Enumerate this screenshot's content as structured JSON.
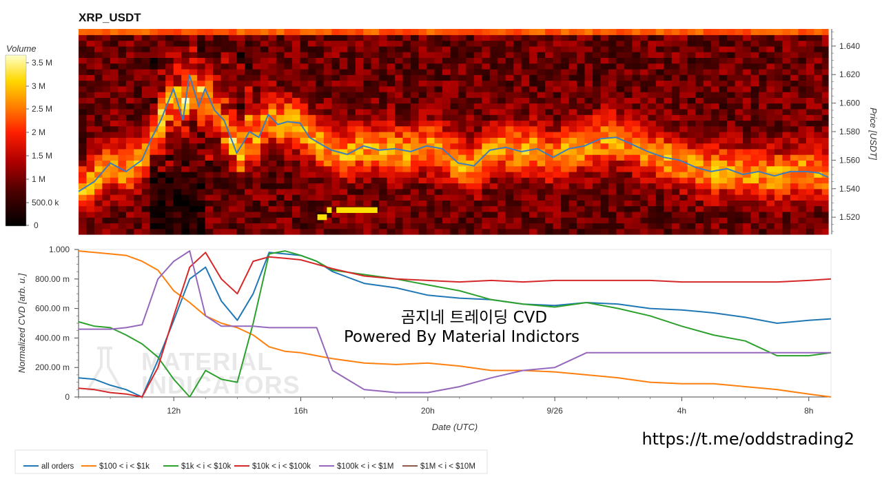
{
  "title": "XRP_USDT",
  "heatmap": {
    "colorbar_title": "Volume",
    "colorbar_ticks": [
      "3.5 M",
      "3 M",
      "2.5 M",
      "2 M",
      "1.5 M",
      "1 M",
      "500.0 k",
      "0"
    ],
    "price_ticks": [
      "1.640",
      "1.620",
      "1.600",
      "1.580",
      "1.560",
      "1.540",
      "1.520"
    ],
    "price_label": "Price [USDT]"
  },
  "cvd": {
    "ylabel": "Normalized CVD [arb. u.]",
    "xlabel": "Date (UTC)",
    "y_ticks": [
      "0",
      "200.00 m",
      "400.00 m",
      "600.00 m",
      "800.00 m",
      "1.000"
    ],
    "x_ticks": [
      "12h",
      "16h",
      "20h",
      "9/26",
      "4h",
      "8h"
    ]
  },
  "watermark": {
    "line1": "곰지네 트레이딩 CVD",
    "line2": "Powered By Material Indictors",
    "logo_text1": "MATERIAL",
    "logo_text2": "INDICATORS",
    "url": "https://t.me/oddstrading2"
  },
  "legend": [
    {
      "label": "all orders",
      "color": "#1f77b4"
    },
    {
      "label": "$100 < i < $1k",
      "color": "#ff7f0e"
    },
    {
      "label": "$1k < i < $10k",
      "color": "#2ca02c"
    },
    {
      "label": "$10k < i < $100k",
      "color": "#d62728"
    },
    {
      "label": "$100k < i < $1M",
      "color": "#9467bd"
    },
    {
      "label": "$1M < i < $10M",
      "color": "#8c564b"
    }
  ],
  "chart_data": [
    {
      "type": "heatmap",
      "title": "XRP_USDT",
      "x_range_hours": [
        9.0,
        32.7
      ],
      "ylim": [
        1.508,
        1.652
      ],
      "ylabel": "Price [USDT]",
      "colorbar": {
        "label": "Volume",
        "range": [
          0,
          3700000
        ]
      },
      "price_line": {
        "name": "price",
        "color": "#3b7dbf",
        "x": [
          9.0,
          9.5,
          10.0,
          10.5,
          11.0,
          11.3,
          11.6,
          12.0,
          12.3,
          12.5,
          12.8,
          13.0,
          13.3,
          13.6,
          14.0,
          14.2,
          14.4,
          14.7,
          15.0,
          15.3,
          15.6,
          16.0,
          16.3,
          16.6,
          17.0,
          17.5,
          18.0,
          18.5,
          19.0,
          19.5,
          20.0,
          20.5,
          21.0,
          21.5,
          22.0,
          22.5,
          23.0,
          23.5,
          24.0,
          24.5,
          25.0,
          25.5,
          26.0,
          26.5,
          27.0,
          27.5,
          28.0,
          28.5,
          29.0,
          29.5,
          30.0,
          30.5,
          31.0,
          31.5,
          32.0,
          32.4,
          32.7
        ],
        "y": [
          1.538,
          1.545,
          1.558,
          1.552,
          1.56,
          1.575,
          1.588,
          1.61,
          1.588,
          1.62,
          1.598,
          1.61,
          1.595,
          1.588,
          1.565,
          1.572,
          1.58,
          1.576,
          1.592,
          1.585,
          1.587,
          1.586,
          1.576,
          1.572,
          1.567,
          1.564,
          1.57,
          1.567,
          1.568,
          1.566,
          1.57,
          1.568,
          1.558,
          1.556,
          1.567,
          1.569,
          1.566,
          1.568,
          1.562,
          1.568,
          1.57,
          1.575,
          1.576,
          1.571,
          1.566,
          1.562,
          1.56,
          1.555,
          1.552,
          1.554,
          1.55,
          1.552,
          1.549,
          1.552,
          1.552,
          1.551,
          1.548
        ]
      },
      "highlight_cells": [
        {
          "x": [
            16.85,
            17.0
          ],
          "y": [
            1.523,
            1.527
          ],
          "value": 3700000
        },
        {
          "x": [
            17.15,
            18.45
          ],
          "y": [
            1.523,
            1.527
          ],
          "value": 3700000
        },
        {
          "x": [
            16.55,
            16.85
          ],
          "y": [
            1.518,
            1.522
          ],
          "value": 3700000
        }
      ]
    },
    {
      "type": "line",
      "xlabel": "Date (UTC)",
      "ylabel": "Normalized CVD [arb. u.]",
      "x_range_hours": [
        9.0,
        32.7
      ],
      "ylim": [
        0,
        1.0
      ],
      "x_tick_positions_hours": [
        12,
        16,
        20,
        24,
        28,
        32
      ],
      "x_tick_labels": [
        "12h",
        "16h",
        "20h",
        "9/26",
        "4h",
        "8h"
      ],
      "x": [
        9.0,
        9.5,
        10.0,
        10.5,
        11.0,
        11.5,
        12.0,
        12.5,
        13.0,
        13.5,
        14.0,
        14.5,
        15.0,
        15.5,
        16.0,
        16.5,
        17.0,
        18.0,
        19.0,
        20.0,
        21.0,
        22.0,
        23.0,
        24.0,
        25.0,
        26.0,
        27.0,
        28.0,
        29.0,
        30.0,
        31.0,
        32.0,
        32.7
      ],
      "series": [
        {
          "name": "all orders",
          "color": "#1f77b4",
          "values": [
            0.13,
            0.12,
            0.08,
            0.05,
            0.0,
            0.25,
            0.52,
            0.8,
            0.88,
            0.65,
            0.52,
            0.7,
            0.98,
            0.97,
            0.96,
            0.92,
            0.85,
            0.77,
            0.74,
            0.69,
            0.67,
            0.66,
            0.63,
            0.62,
            0.64,
            0.63,
            0.6,
            0.59,
            0.57,
            0.54,
            0.5,
            0.52,
            0.53
          ]
        },
        {
          "name": "$100 < i < $1k",
          "color": "#ff7f0e",
          "values": [
            0.99,
            0.98,
            0.97,
            0.96,
            0.92,
            0.86,
            0.72,
            0.64,
            0.55,
            0.5,
            0.47,
            0.42,
            0.34,
            0.31,
            0.3,
            0.28,
            0.26,
            0.23,
            0.22,
            0.23,
            0.21,
            0.18,
            0.18,
            0.17,
            0.15,
            0.13,
            0.1,
            0.09,
            0.09,
            0.07,
            0.05,
            0.02,
            0.0
          ]
        },
        {
          "name": "$1k < i < $10k",
          "color": "#2ca02c",
          "values": [
            0.51,
            0.48,
            0.47,
            0.42,
            0.36,
            0.27,
            0.12,
            0.0,
            0.18,
            0.12,
            0.1,
            0.5,
            0.97,
            0.99,
            0.96,
            0.92,
            0.86,
            0.83,
            0.8,
            0.76,
            0.72,
            0.66,
            0.63,
            0.61,
            0.64,
            0.6,
            0.55,
            0.48,
            0.42,
            0.38,
            0.28,
            0.28,
            0.3
          ]
        },
        {
          "name": "$10k < i < $100k",
          "color": "#d62728",
          "values": [
            0.06,
            0.05,
            0.03,
            0.02,
            0.0,
            0.2,
            0.55,
            0.88,
            0.98,
            0.8,
            0.7,
            0.92,
            0.95,
            0.94,
            0.93,
            0.9,
            0.87,
            0.82,
            0.8,
            0.79,
            0.78,
            0.79,
            0.78,
            0.79,
            0.79,
            0.79,
            0.79,
            0.78,
            0.78,
            0.78,
            0.78,
            0.79,
            0.8
          ]
        },
        {
          "name": "$100k < i < $1M",
          "color": "#9467bd",
          "values": [
            0.46,
            0.46,
            0.46,
            0.47,
            0.49,
            0.8,
            0.92,
            0.99,
            0.55,
            0.48,
            0.48,
            0.48,
            0.47,
            0.47,
            0.47,
            0.47,
            0.18,
            0.05,
            0.03,
            0.03,
            0.07,
            0.13,
            0.18,
            0.2,
            0.3,
            0.3,
            0.3,
            0.3,
            0.3,
            0.3,
            0.3,
            0.3,
            0.3
          ]
        },
        {
          "name": "$1M < i < $10M",
          "color": "#8c564b",
          "values": []
        }
      ]
    }
  ]
}
